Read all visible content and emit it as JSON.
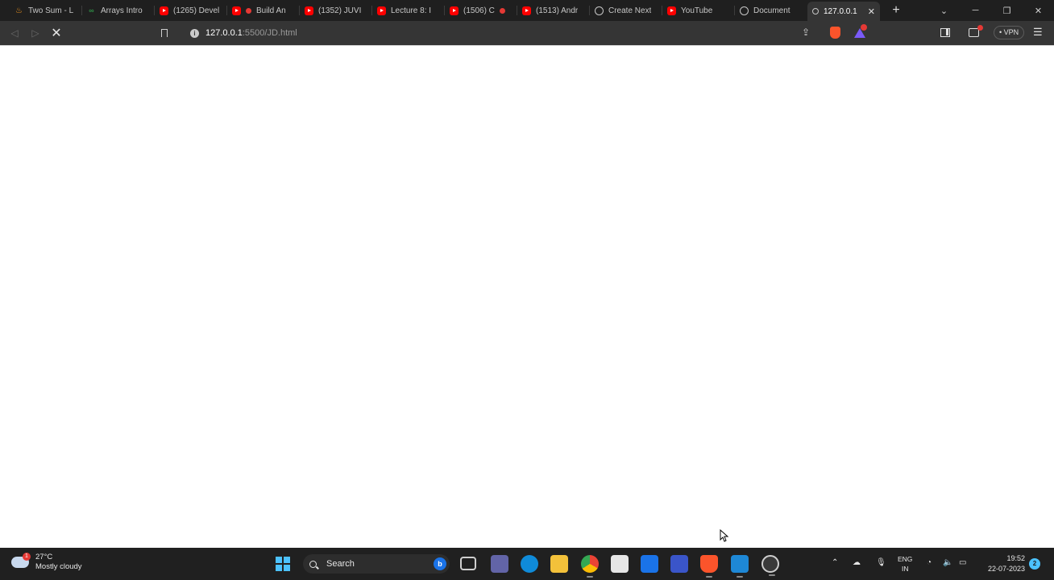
{
  "tabs": [
    {
      "title": "Two Sum - L",
      "icon": "java-icon"
    },
    {
      "title": "Arrays Intro",
      "icon": "gfg-icon"
    },
    {
      "title": "(1265) Devel",
      "icon": "youtube-icon"
    },
    {
      "title": "Build An",
      "icon": "youtube-icon"
    },
    {
      "title": "(1352) JUVI",
      "icon": "youtube-icon"
    },
    {
      "title": "Lecture 8: I",
      "icon": "youtube-icon"
    },
    {
      "title": "(1506) C",
      "icon": "youtube-icon"
    },
    {
      "title": "(1513) Andr",
      "icon": "youtube-icon"
    },
    {
      "title": "Create Next",
      "icon": "globe-icon"
    },
    {
      "title": "YouTube",
      "icon": "youtube-icon"
    },
    {
      "title": "Document",
      "icon": "globe-icon"
    },
    {
      "title": "127.0.0.1",
      "icon": "globe-icon",
      "active": true
    }
  ],
  "toolbar": {
    "url_host": "127.0.0.1",
    "url_path": ":5500/JD.html",
    "vpn_label": "VPN"
  },
  "taskbar": {
    "weather_temp": "27°C",
    "weather_desc": "Mostly cloudy",
    "weather_badge": "1",
    "search_label": "Search",
    "lang_line1": "ENG",
    "lang_line2": "IN",
    "time": "19:52",
    "date": "22-07-2023",
    "notification_count": "2"
  },
  "colors": {
    "chrome_dark": "#1f1f1f",
    "toolbar": "#353535",
    "taskbar": "#202020",
    "accent": "#4cc2ff",
    "youtube_red": "#ff0000",
    "brave_orange": "#fb542b"
  }
}
